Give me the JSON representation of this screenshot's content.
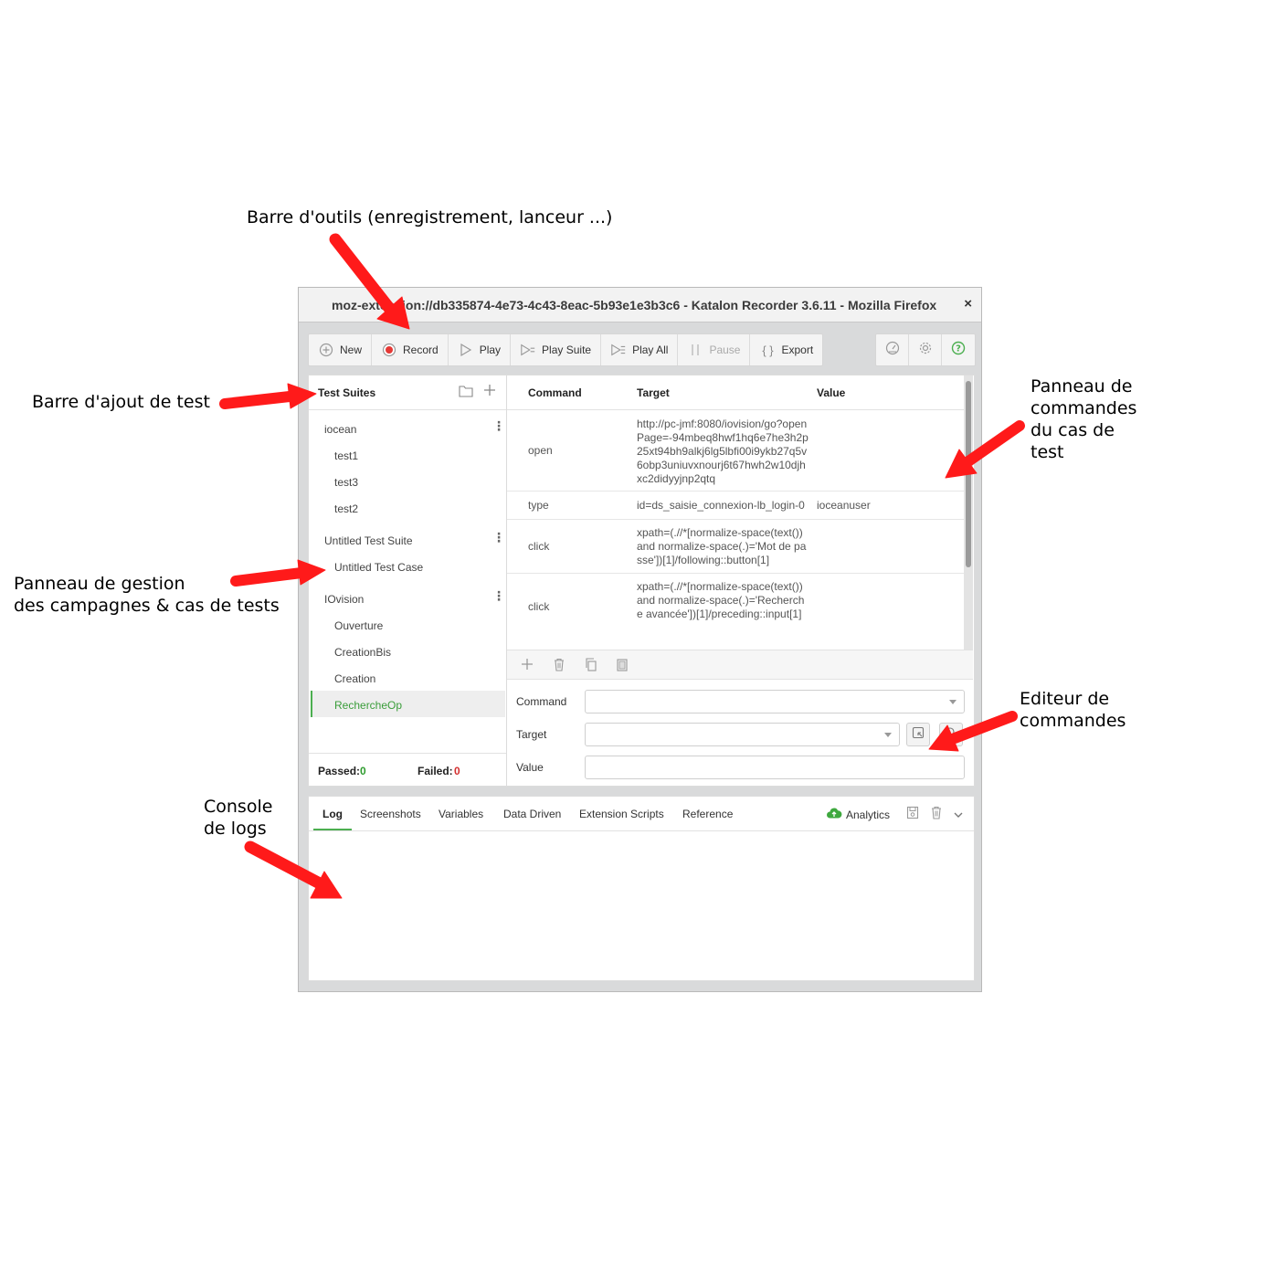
{
  "annotations": {
    "toolbar": "Barre d'outils (enregistrement, lanceur ...)",
    "add_test": "Barre d'ajout de test",
    "commands_panel": "Panneau de\ncommandes\ndu cas de\ntest",
    "campaign_panel": "Panneau de gestion\ndes campagnes & cas de tests",
    "editor": "Editeur de\ncommandes",
    "console": "Console\nde logs",
    "arrow_color": "#ff1a1a"
  },
  "window": {
    "title": "moz-extension://db335874-4e73-4c43-8eac-5b93e1e3b3c6 - Katalon Recorder 3.6.11 - Mozilla Firefox",
    "close": "×"
  },
  "toolbar": {
    "buttons": [
      {
        "label": "New",
        "icon": "plus-circle-icon"
      },
      {
        "label": "Record",
        "icon": "record-icon"
      },
      {
        "label": "Play",
        "icon": "play-icon"
      },
      {
        "label": "Play Suite",
        "icon": "play-suite-icon"
      },
      {
        "label": "Play All",
        "icon": "play-all-icon"
      },
      {
        "label": "Pause",
        "icon": "pause-icon",
        "disabled": true
      },
      {
        "label": "Export",
        "icon": "braces-icon"
      }
    ],
    "right_icons": [
      "speedometer-icon",
      "gear-icon",
      "help-icon"
    ],
    "record_color": "#e53935",
    "help_color": "#4caf50"
  },
  "sidebar": {
    "title": "Test Suites",
    "suites": [
      {
        "name": "iocean",
        "cases": [
          "test1",
          "test3",
          "test2"
        ]
      },
      {
        "name": "Untitled Test Suite",
        "cases": [
          "Untitled Test Case"
        ]
      },
      {
        "name": "IOvision",
        "cases": [
          "Ouverture",
          "CreationBis",
          "Creation",
          "RechercheOp"
        ]
      }
    ],
    "active_case": "RechercheOp",
    "active_color": "#4caf50",
    "passed_label": "Passed:",
    "passed_count": "0",
    "failed_label": "Failed:",
    "failed_count": "0"
  },
  "commands": {
    "headers": {
      "command": "Command",
      "target": "Target",
      "value": "Value"
    },
    "rows": [
      {
        "command": "open",
        "target": "http://pc-jmf:8080/iovision/go?openPage=-94mbeq8hwf1hq6e7he3h2p25xt94bh9alkj6lg5lbfi00i9ykb27q5v6obp3uniuvxnourj6t67hwh2w10djhxc2didyyjnp2qtq",
        "value": ""
      },
      {
        "command": "type",
        "target": "id=ds_saisie_connexion-lb_login-0",
        "value": "ioceanuser"
      },
      {
        "command": "click",
        "target": "xpath=(.//*[normalize-space(text()) and normalize-space(.)='Mot de passe'])[1]/following::button[1]",
        "value": ""
      },
      {
        "command": "click",
        "target": "xpath=(.//*[normalize-space(text()) and normalize-space(.)='Recherche avancée'])[1]/preceding::input[1]",
        "value": ""
      }
    ]
  },
  "editor": {
    "command_label": "Command",
    "target_label": "Target",
    "value_label": "Value",
    "command_value": "",
    "target_value": "",
    "value_value": ""
  },
  "console": {
    "tabs": [
      "Log",
      "Screenshots",
      "Variables",
      "Data Driven",
      "Extension Scripts",
      "Reference"
    ],
    "active_tab": "Log",
    "analytics_label": "Analytics"
  }
}
